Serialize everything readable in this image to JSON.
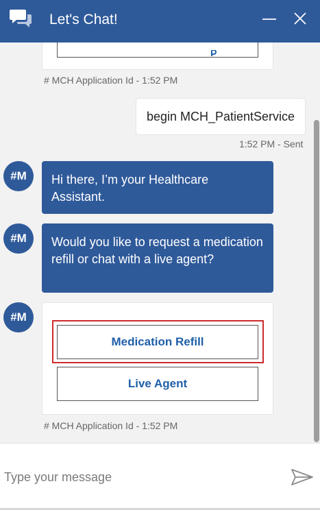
{
  "header": {
    "title": "Let's Chat!"
  },
  "transcript": {
    "top_card": {
      "meta": "# MCH Application Id - 1:52 PM"
    },
    "user_message": {
      "text": "begin MCH_PatientService",
      "meta": "1:52 PM - Sent"
    },
    "bot_messages": [
      {
        "avatar": "#M",
        "text": "Hi there, I’m your Healthcare Assistant."
      },
      {
        "avatar": "#M",
        "text": "Would you like to request a medication refill or chat with a live agent?"
      }
    ],
    "choice_card": {
      "avatar": "#M",
      "buttons": [
        {
          "label": "Medication Refill",
          "highlighted": true
        },
        {
          "label": "Live Agent",
          "highlighted": false
        }
      ],
      "meta": "# MCH Application Id - 1:52 PM"
    }
  },
  "input": {
    "placeholder": "Type your message"
  },
  "colors": {
    "header_bg": "#2f5a9a",
    "bubble_bg": "#2f5a9a",
    "button_text": "#1f5fa8",
    "highlight": "#cc2a2a"
  }
}
